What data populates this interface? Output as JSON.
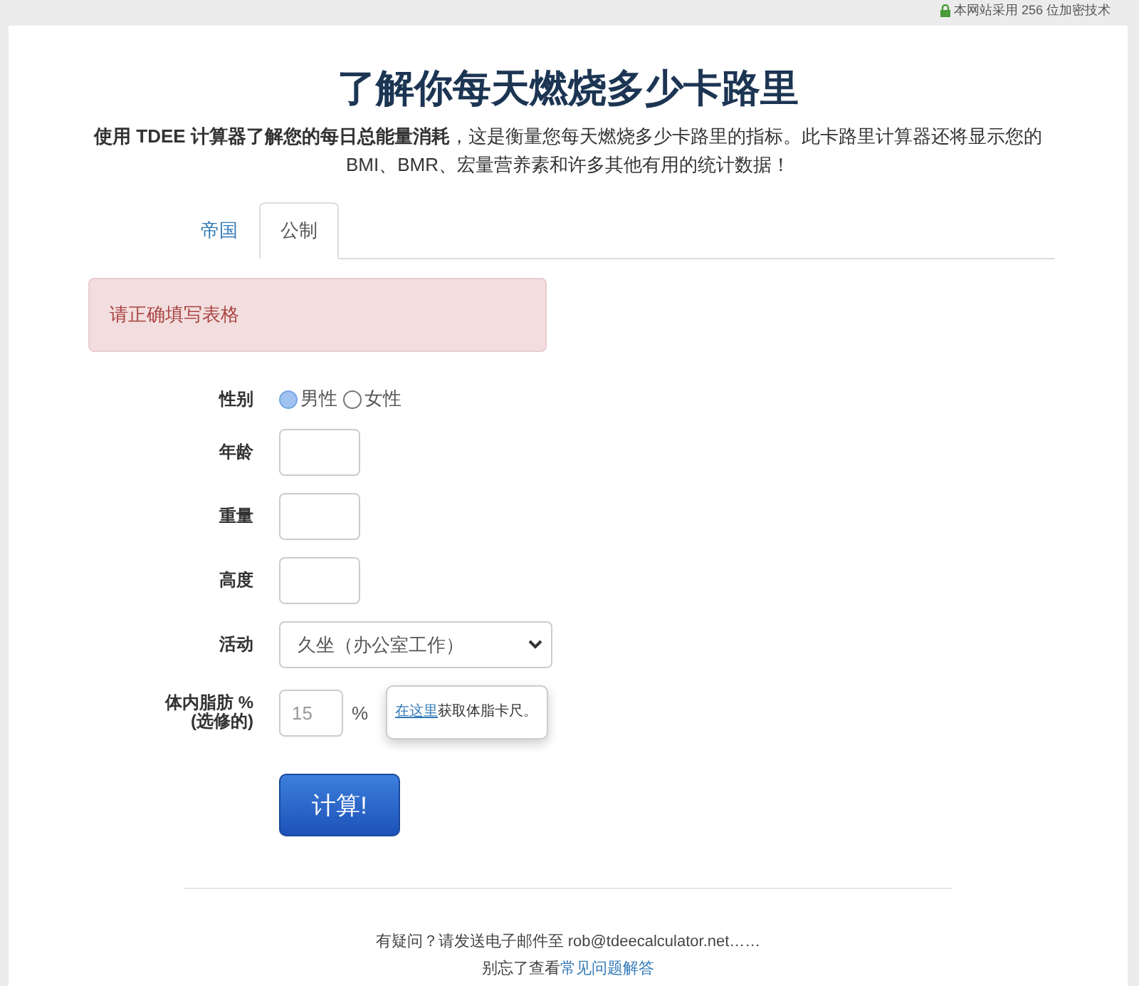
{
  "top_bar": {
    "security_note": "本网站采用 256 位加密技术"
  },
  "title": "了解你每天燃烧多少卡路里",
  "intro": "**使用 TDEE 计算器了解您的每日总能量消耗**，这是衡量您每天燃烧多少卡路里的指标。此卡路里计算器还将显示您的BMI、BMR、宏量营养素和许多其他有用的统计数据！",
  "tabs": [
    {
      "label": "帝国",
      "selected": false
    },
    {
      "label": "公制",
      "selected": true
    }
  ],
  "alert": "请正确填写表格",
  "form": {
    "gender": {
      "label": "性别",
      "options": [
        {
          "label": "男性",
          "selected": true
        },
        {
          "label": "女性",
          "selected": false
        }
      ]
    },
    "fields": [
      {
        "label": "年龄"
      },
      {
        "label": "重量"
      },
      {
        "label": "高度"
      }
    ],
    "activity": {
      "label": "活动",
      "value": "久坐（办公室工作）"
    },
    "body_fat": {
      "label": "体内脂肪 %",
      "sublabel": "(选修的)",
      "placeholder": "15",
      "unit": "%",
      "popover": {
        "link": "在这里",
        "text": "获取体脂卡尺。"
      }
    },
    "submit": "计算!"
  },
  "footer": {
    "contact": "有疑问？请发送电子邮件至 rob@tdeecalculator.net……",
    "faq_prefix": "别忘了查看",
    "faq_link": "常见问题解答"
  }
}
